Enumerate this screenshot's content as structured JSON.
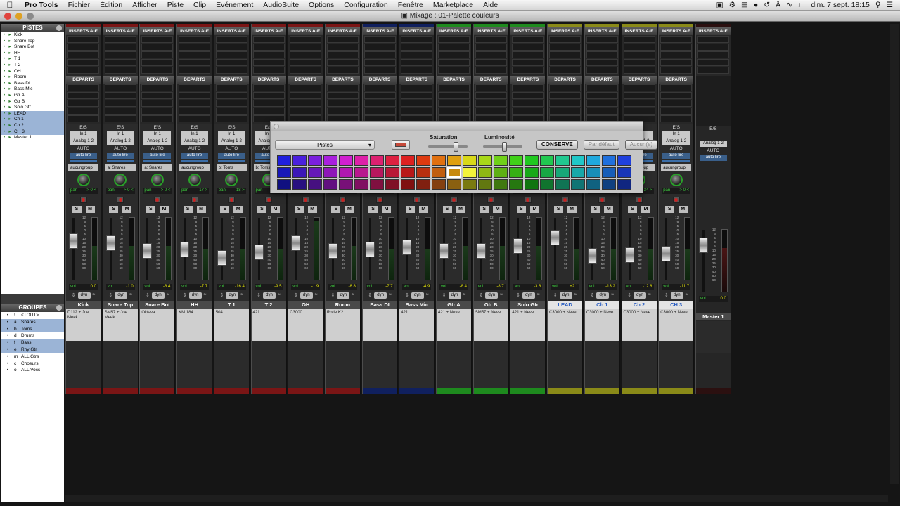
{
  "menubar": {
    "apple": "",
    "app": "Pro Tools",
    "items": [
      "Fichier",
      "Édition",
      "Afficher",
      "Piste",
      "Clip",
      "Evénement",
      "AudioSuite",
      "Options",
      "Configuration",
      "Fenêtre",
      "Marketplace",
      "Aide"
    ],
    "clock": "dim. 7 sept.  18:15"
  },
  "window": {
    "title": "Mixage : 01-Palette couleurs"
  },
  "tracks_panel": {
    "title": "PISTES",
    "items": [
      {
        "name": "Kick",
        "sel": false
      },
      {
        "name": "Snare Top",
        "sel": false
      },
      {
        "name": "Snare Bot",
        "sel": false
      },
      {
        "name": "HH",
        "sel": false
      },
      {
        "name": "T 1",
        "sel": false
      },
      {
        "name": "T 2",
        "sel": false
      },
      {
        "name": "OH",
        "sel": false
      },
      {
        "name": "Room",
        "sel": false
      },
      {
        "name": "Bass DI",
        "sel": false
      },
      {
        "name": "Bass Mic",
        "sel": false
      },
      {
        "name": "Gtr A",
        "sel": false
      },
      {
        "name": "Gtr B",
        "sel": false
      },
      {
        "name": "Solo Gtr",
        "sel": false
      },
      {
        "name": "LEAD",
        "sel": true
      },
      {
        "name": "Ch 1",
        "sel": true
      },
      {
        "name": "Ch 2",
        "sel": true
      },
      {
        "name": "CH 3",
        "sel": true
      },
      {
        "name": "Master 1",
        "sel": false
      }
    ]
  },
  "groups_panel": {
    "title": "GROUPES",
    "items": [
      {
        "key": "!",
        "name": "<TOUT>",
        "sel": false
      },
      {
        "key": "a",
        "name": "Snares",
        "sel": true
      },
      {
        "key": "b",
        "name": "Toms",
        "sel": true
      },
      {
        "key": "d",
        "name": "Drums",
        "sel": false
      },
      {
        "key": "f",
        "name": "Bass",
        "sel": true
      },
      {
        "key": "e",
        "name": "Rhy Gtr",
        "sel": true
      },
      {
        "key": "m",
        "name": "ALL Gtrs",
        "sel": false
      },
      {
        "key": "c",
        "name": "Choeurs",
        "sel": false
      },
      {
        "key": "o",
        "name": "ALL Vocs",
        "sel": false
      }
    ]
  },
  "labels": {
    "inserts": "INSERTS A-E",
    "sends": "DEPARTS",
    "es": "E/S",
    "auto": "AUTO",
    "pan": "pan",
    "vol": "vol",
    "s": "S",
    "m": "M",
    "dyn": "dyn",
    "master_out": "Analog 1-2"
  },
  "strips": [
    {
      "name": "Kick",
      "in": "In 1",
      "out": "Analog 1-2",
      "auto": "auto lire",
      "group": "aucungroup",
      "pan": "> 0 <",
      "vol": "0.0",
      "comment": "D112 + Joe Meek",
      "color": "#7a1515",
      "hl": false,
      "fader": 0.65,
      "meter": 0.55
    },
    {
      "name": "Snare Top",
      "in": "In 1",
      "out": "Analog 1-2",
      "auto": "auto lire",
      "group": "a: Snares",
      "pan": "> 0 <",
      "vol": "-1.0",
      "comment": "SM57 + Joe Meek",
      "color": "#7a1515",
      "hl": false,
      "fader": 0.6,
      "meter": 0.55
    },
    {
      "name": "Snare Bot",
      "in": "In 1",
      "out": "Analog 1-2",
      "auto": "auto lire",
      "group": "a: Snares",
      "pan": "> 0 <",
      "vol": "-8.4",
      "comment": "Oktava",
      "color": "#7a1515",
      "hl": false,
      "fader": 0.45,
      "meter": 0.55
    },
    {
      "name": "HH",
      "in": "In 1",
      "out": "Analog 1-2",
      "auto": "auto lire",
      "group": "aucungroup",
      "pan": "17 >",
      "vol": "-7.7",
      "comment": "KM 184",
      "color": "#7a1515",
      "hl": false,
      "fader": 0.47,
      "meter": 0.5
    },
    {
      "name": "T 1",
      "in": "In 1",
      "out": "Analog 1-2",
      "auto": "auto lire",
      "group": "b: Toms",
      "pan": "18 >",
      "vol": "-16.4",
      "comment": "504",
      "color": "#7a1515",
      "hl": false,
      "fader": 0.3,
      "meter": 0.5
    },
    {
      "name": "T 2",
      "in": "In 1",
      "out": "Analog 1-2",
      "auto": "auto lire",
      "group": "b: Toms",
      "pan": "< 56",
      "vol": "-9.5",
      "comment": "421",
      "color": "#7a1515",
      "hl": false,
      "fader": 0.42,
      "meter": 0.5
    },
    {
      "name": "OH",
      "in": "In 1",
      "out": "Analog 1-2",
      "auto": "auto lire",
      "group": "aucungroup",
      "pan": "< 80   80 >",
      "vol": "-1.9",
      "comment": "C3000",
      "color": "#7a1515",
      "hl": false,
      "fader": 0.6,
      "meter": 0.95
    },
    {
      "name": "Room",
      "in": "In 1",
      "out": "Analog 1-2",
      "auto": "auto lire",
      "group": "aucungroup",
      "pan": "> 0 <",
      "vol": "-8.8",
      "comment": "Rode K2",
      "color": "#7a1515",
      "hl": false,
      "fader": 0.45,
      "meter": 0.55
    },
    {
      "name": "Bass DI",
      "in": "In 1",
      "out": "Analog 1-2",
      "auto": "auto lire",
      "group": "aucungroup",
      "pan": "> 0 <",
      "vol": "-7.7",
      "comment": "",
      "color": "#10205e",
      "hl": false,
      "fader": 0.47,
      "meter": 0.5
    },
    {
      "name": "Bass Mic",
      "in": "In 1",
      "out": "Analog 1-2",
      "auto": "auto lire",
      "group": "aucungroup",
      "pan": "> 0 <",
      "vol": "-4.9",
      "comment": "421",
      "color": "#10205e",
      "hl": false,
      "fader": 0.52,
      "meter": 0.5
    },
    {
      "name": "Gtr A",
      "in": "In 1",
      "out": "Analog 1-2",
      "auto": "auto lire",
      "group": "aucungroup",
      "pan": "< 50",
      "vol": "-8.4",
      "comment": "421 + Neve",
      "color": "#1e8a1e",
      "hl": false,
      "fader": 0.45,
      "meter": 0.55
    },
    {
      "name": "Gtr B",
      "in": "In 1",
      "out": "Analog 1-2",
      "auto": "auto lire",
      "group": "aucungroup",
      "pan": "50 >",
      "vol": "-8.7",
      "comment": "SM57 + Neve",
      "color": "#1e8a1e",
      "hl": false,
      "fader": 0.45,
      "meter": 0.55
    },
    {
      "name": "Solo Gtr",
      "in": "In 1",
      "out": "Analog 1-2",
      "auto": "auto lire",
      "group": "aucungroup",
      "pan": "> 0 <",
      "vol": "-3.8",
      "comment": "421 + Neve",
      "color": "#1e8a1e",
      "hl": false,
      "fader": 0.55,
      "meter": 0.55
    },
    {
      "name": "LEAD",
      "in": "In 1",
      "out": "Analog 1-2",
      "auto": "auto lire",
      "group": "aucungroup",
      "pan": "> 0 <",
      "vol": "+2.1",
      "comment": "C3000 + Neve",
      "color": "#8a8a18",
      "hl": true,
      "fader": 0.72,
      "meter": 0.5
    },
    {
      "name": "Ch 1",
      "in": "In 1",
      "out": "Analog 1-2",
      "auto": "auto lire",
      "group": "aucungroup",
      "pan": "< 34",
      "vol": "-13.2",
      "comment": "C3000 + Neve",
      "color": "#8a8a18",
      "hl": true,
      "fader": 0.35,
      "meter": 0.5
    },
    {
      "name": "Ch 2",
      "in": "In 1",
      "out": "Analog 1-2",
      "auto": "auto lire",
      "group": "aucungroup",
      "pan": "34 >",
      "vol": "-12.8",
      "comment": "C3000 + Neve",
      "color": "#8a8a18",
      "hl": true,
      "fader": 0.36,
      "meter": 0.5
    },
    {
      "name": "CH 3",
      "in": "In 1",
      "out": "Analog 1-2",
      "auto": "auto lire",
      "group": "aucungroup",
      "pan": "> 0 <",
      "vol": "-11.7",
      "comment": "C3000 + Neve",
      "color": "#8a8a18",
      "hl": true,
      "fader": 0.38,
      "meter": 0.5
    }
  ],
  "master": {
    "name": "Master 1",
    "out": "Analog 1-2",
    "auto": "auto lire",
    "vol": "0.0",
    "color": "#2b1010"
  },
  "fader_scale": [
    "12",
    "6",
    "5",
    "0",
    "5",
    "10",
    "15",
    "20",
    "25",
    "30",
    "40",
    "50",
    "60"
  ],
  "palette": {
    "select": "Pistes",
    "saturation_label": "Saturation",
    "luminosity_label": "Luminosité",
    "saturation": 0.73,
    "luminosity": 0.55,
    "btn_conserve": "CONSERVE",
    "btn_default": "Par défaut",
    "btn_none": "Aucun(e)",
    "selected_row": 1,
    "selected_col": 11,
    "rows": [
      [
        "#2020dd",
        "#4a20dd",
        "#7a20dd",
        "#a820dd",
        "#d020d0",
        "#dd20a8",
        "#dd2070",
        "#dd2040",
        "#dd2020",
        "#dd3a10",
        "#e07010",
        "#e0a010",
        "#d8d818",
        "#a8d818",
        "#70d018",
        "#40d018",
        "#20c820",
        "#20c850",
        "#20c890",
        "#20c8c8",
        "#20a8dd",
        "#2070dd",
        "#2040dd"
      ],
      [
        "#1818b8",
        "#3c18b8",
        "#6618b8",
        "#8e18b8",
        "#b018b0",
        "#b8188e",
        "#b8185e",
        "#b81836",
        "#b81818",
        "#b83010",
        "#c05e10",
        "#c88a10",
        "#f2f23a",
        "#8eb814",
        "#5eb014",
        "#36b014",
        "#18a818",
        "#18a844",
        "#18a878",
        "#18a8a8",
        "#188eb8",
        "#185eb8",
        "#1836b8"
      ],
      [
        "#101080",
        "#281080",
        "#461080",
        "#621080",
        "#781078",
        "#801062",
        "#801040",
        "#801026",
        "#801010",
        "#802010",
        "#844010",
        "#8a6010",
        "#7a7a10",
        "#627810",
        "#407810",
        "#267810",
        "#107410",
        "#10742e",
        "#107454",
        "#107474",
        "#106280",
        "#104080",
        "#102680"
      ]
    ]
  }
}
